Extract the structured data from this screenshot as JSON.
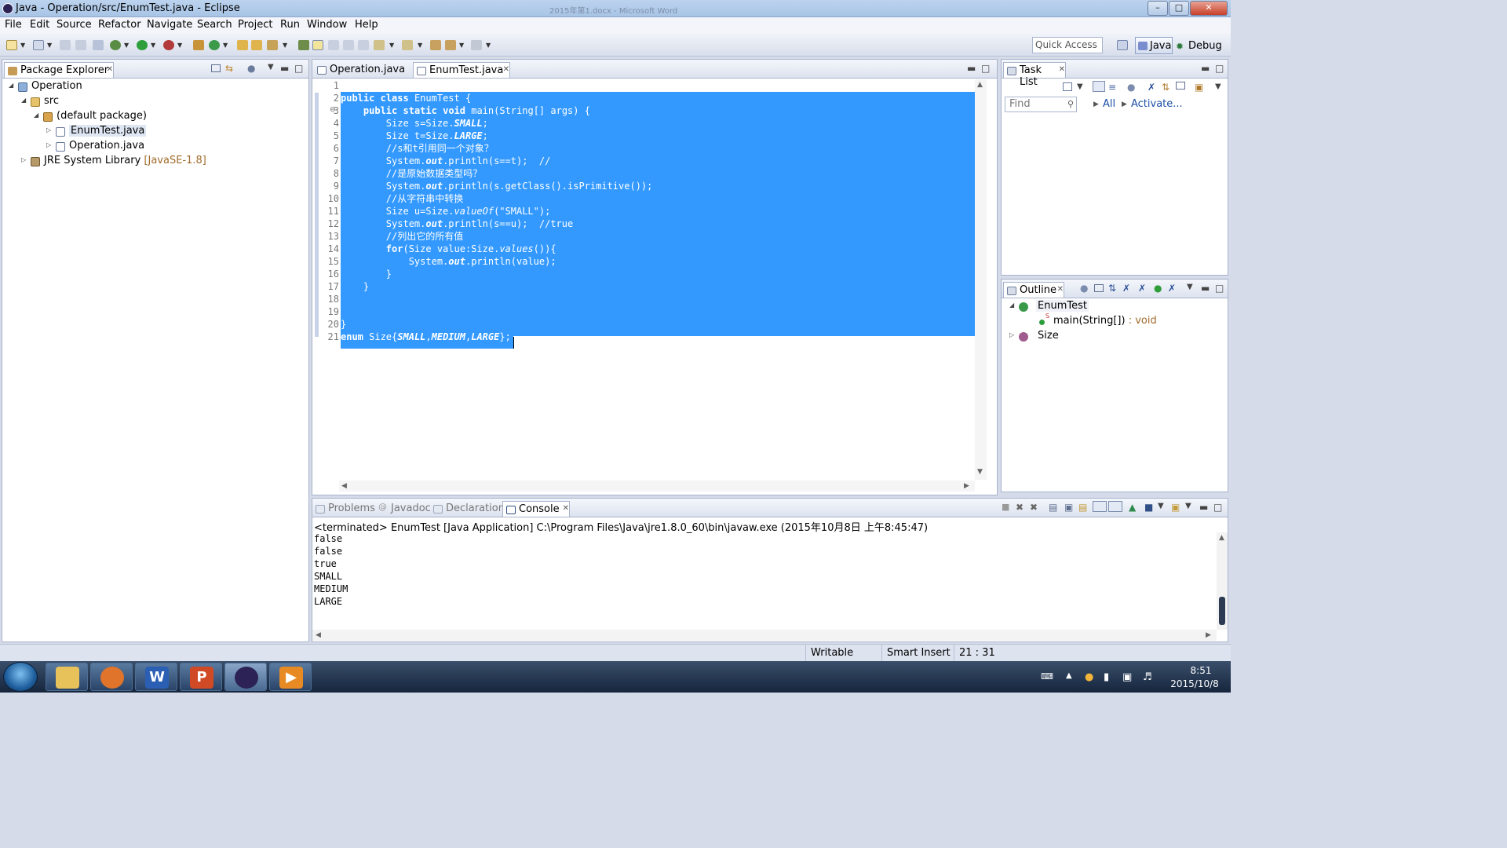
{
  "window": {
    "title": "Java - Operation/src/EnumTest.java - Eclipse",
    "background_window_text": "2015年第1.docx - Microsoft Word",
    "min_label": "–",
    "max_label": "□",
    "close_label": "✕"
  },
  "menu": [
    "File",
    "Edit",
    "Source",
    "Refactor",
    "Navigate",
    "Search",
    "Project",
    "Run",
    "Window",
    "Help"
  ],
  "toolbar": {
    "quick_access": "Quick Access",
    "perspectives": {
      "java": "Java",
      "debug": "Debug"
    }
  },
  "package_explorer": {
    "title": "Package Explorer",
    "tree": [
      {
        "label": "Operation",
        "level": 0,
        "expanded": true,
        "icon": "project-icon"
      },
      {
        "label": "src",
        "level": 1,
        "expanded": true,
        "icon": "source-folder-icon"
      },
      {
        "label": "(default package)",
        "level": 2,
        "expanded": true,
        "icon": "package-icon"
      },
      {
        "label": "EnumTest.java",
        "level": 3,
        "expanded": false,
        "icon": "java-file-icon",
        "selected": true
      },
      {
        "label": "Operation.java",
        "level": 3,
        "expanded": false,
        "icon": "java-file-icon"
      },
      {
        "label": "JRE System Library",
        "decoration": "[JavaSE-1.8]",
        "level": 1,
        "expanded": false,
        "icon": "library-icon"
      }
    ]
  },
  "editor": {
    "tabs": [
      {
        "label": "Operation.java",
        "active": false
      },
      {
        "label": "EnumTest.java",
        "active": true
      }
    ],
    "line_numbers": [
      "1",
      "2",
      "3",
      "4",
      "5",
      "6",
      "7",
      "8",
      "9",
      "10",
      "11",
      "12",
      "13",
      "14",
      "15",
      "16",
      "17",
      "18",
      "19",
      "20",
      "21"
    ],
    "code_lines": [
      "",
      "public class EnumTest {",
      "    public static void main(String[] args) {",
      "        Size s=Size.SMALL;",
      "        Size t=Size.LARGE;",
      "        //s和t引用同一个对象？",
      "        System.out.println(s==t);  //",
      "        //是原始数据类型吗？",
      "        System.out.println(s.getClass().isPrimitive());",
      "        //从字符串中转换",
      "        Size u=Size.valueOf(\"SMALL\");",
      "        System.out.println(s==u);  //true",
      "        //列出它的所有值",
      "        for(Size value:Size.values()){",
      "            System.out.println(value);",
      "        }",
      "    }",
      "",
      "",
      "}",
      "enum Size{SMALL,MEDIUM,LARGE};"
    ],
    "fold_marker": "⊖"
  },
  "task_list": {
    "title": "Task List",
    "find_placeholder": "Find",
    "all_link": "All",
    "activate_link": "Activate..."
  },
  "outline": {
    "title": "Outline",
    "items": [
      {
        "label": "EnumTest",
        "detail": "",
        "level": 0,
        "expanded": true
      },
      {
        "label": "main(String[])",
        "detail": " : void",
        "level": 1,
        "superscript": "S"
      },
      {
        "label": "Size",
        "detail": "",
        "level": 0,
        "expanded": false
      }
    ]
  },
  "bottom_panel": {
    "tabs": [
      {
        "label": "Problems",
        "active": false
      },
      {
        "label": "Javadoc",
        "active": false
      },
      {
        "label": "Declaration",
        "active": false
      },
      {
        "label": "Console",
        "active": true
      }
    ],
    "console_header": "<terminated> EnumTest [Java Application] C:\\Program Files\\Java\\jre1.8.0_60\\bin\\javaw.exe (2015年10月8日 上午8:45:47)",
    "output": [
      "false",
      "false",
      "true",
      "SMALL",
      "MEDIUM",
      "LARGE"
    ]
  },
  "status_bar": {
    "writable": "Writable",
    "insert_mode": "Smart Insert",
    "position": "21 : 31"
  },
  "taskbar": {
    "apps": [
      "explorer",
      "ubuntu-style-app",
      "word",
      "powerpoint",
      "eclipse",
      "media-player"
    ],
    "clock_time": "8:51",
    "clock_date": "2015/10/8"
  },
  "colors": {
    "selection": "#3399ff",
    "link": "#1c4fa8",
    "library_decoration": "#a06b2b"
  }
}
